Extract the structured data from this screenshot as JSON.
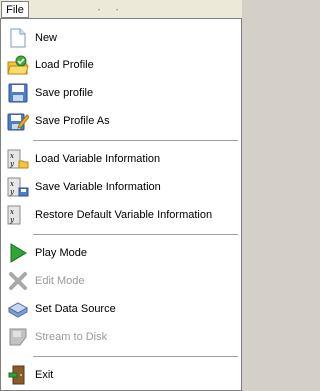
{
  "menubar": {
    "file_label": "File"
  },
  "menu": {
    "items": [
      {
        "label": "New",
        "icon": "new-document-icon"
      },
      {
        "label": "Load Profile",
        "icon": "load-profile-icon"
      },
      {
        "label": "Save profile",
        "icon": "save-profile-icon"
      },
      {
        "label": "Save Profile As",
        "icon": "save-profile-as-icon"
      },
      {
        "label": "Load Variable Information",
        "icon": "load-variable-info-icon"
      },
      {
        "label": "Save Variable Information",
        "icon": "save-variable-info-icon"
      },
      {
        "label": "Restore Default Variable Information",
        "icon": "restore-variable-info-icon"
      },
      {
        "label": "Play Mode",
        "icon": "play-icon"
      },
      {
        "label": "Edit Mode",
        "icon": "edit-mode-icon",
        "disabled": true
      },
      {
        "label": "Set Data Source",
        "icon": "data-source-icon"
      },
      {
        "label": "Stream to Disk",
        "icon": "stream-to-disk-icon",
        "disabled": true
      },
      {
        "label": "Exit",
        "icon": "exit-door-icon"
      }
    ]
  }
}
